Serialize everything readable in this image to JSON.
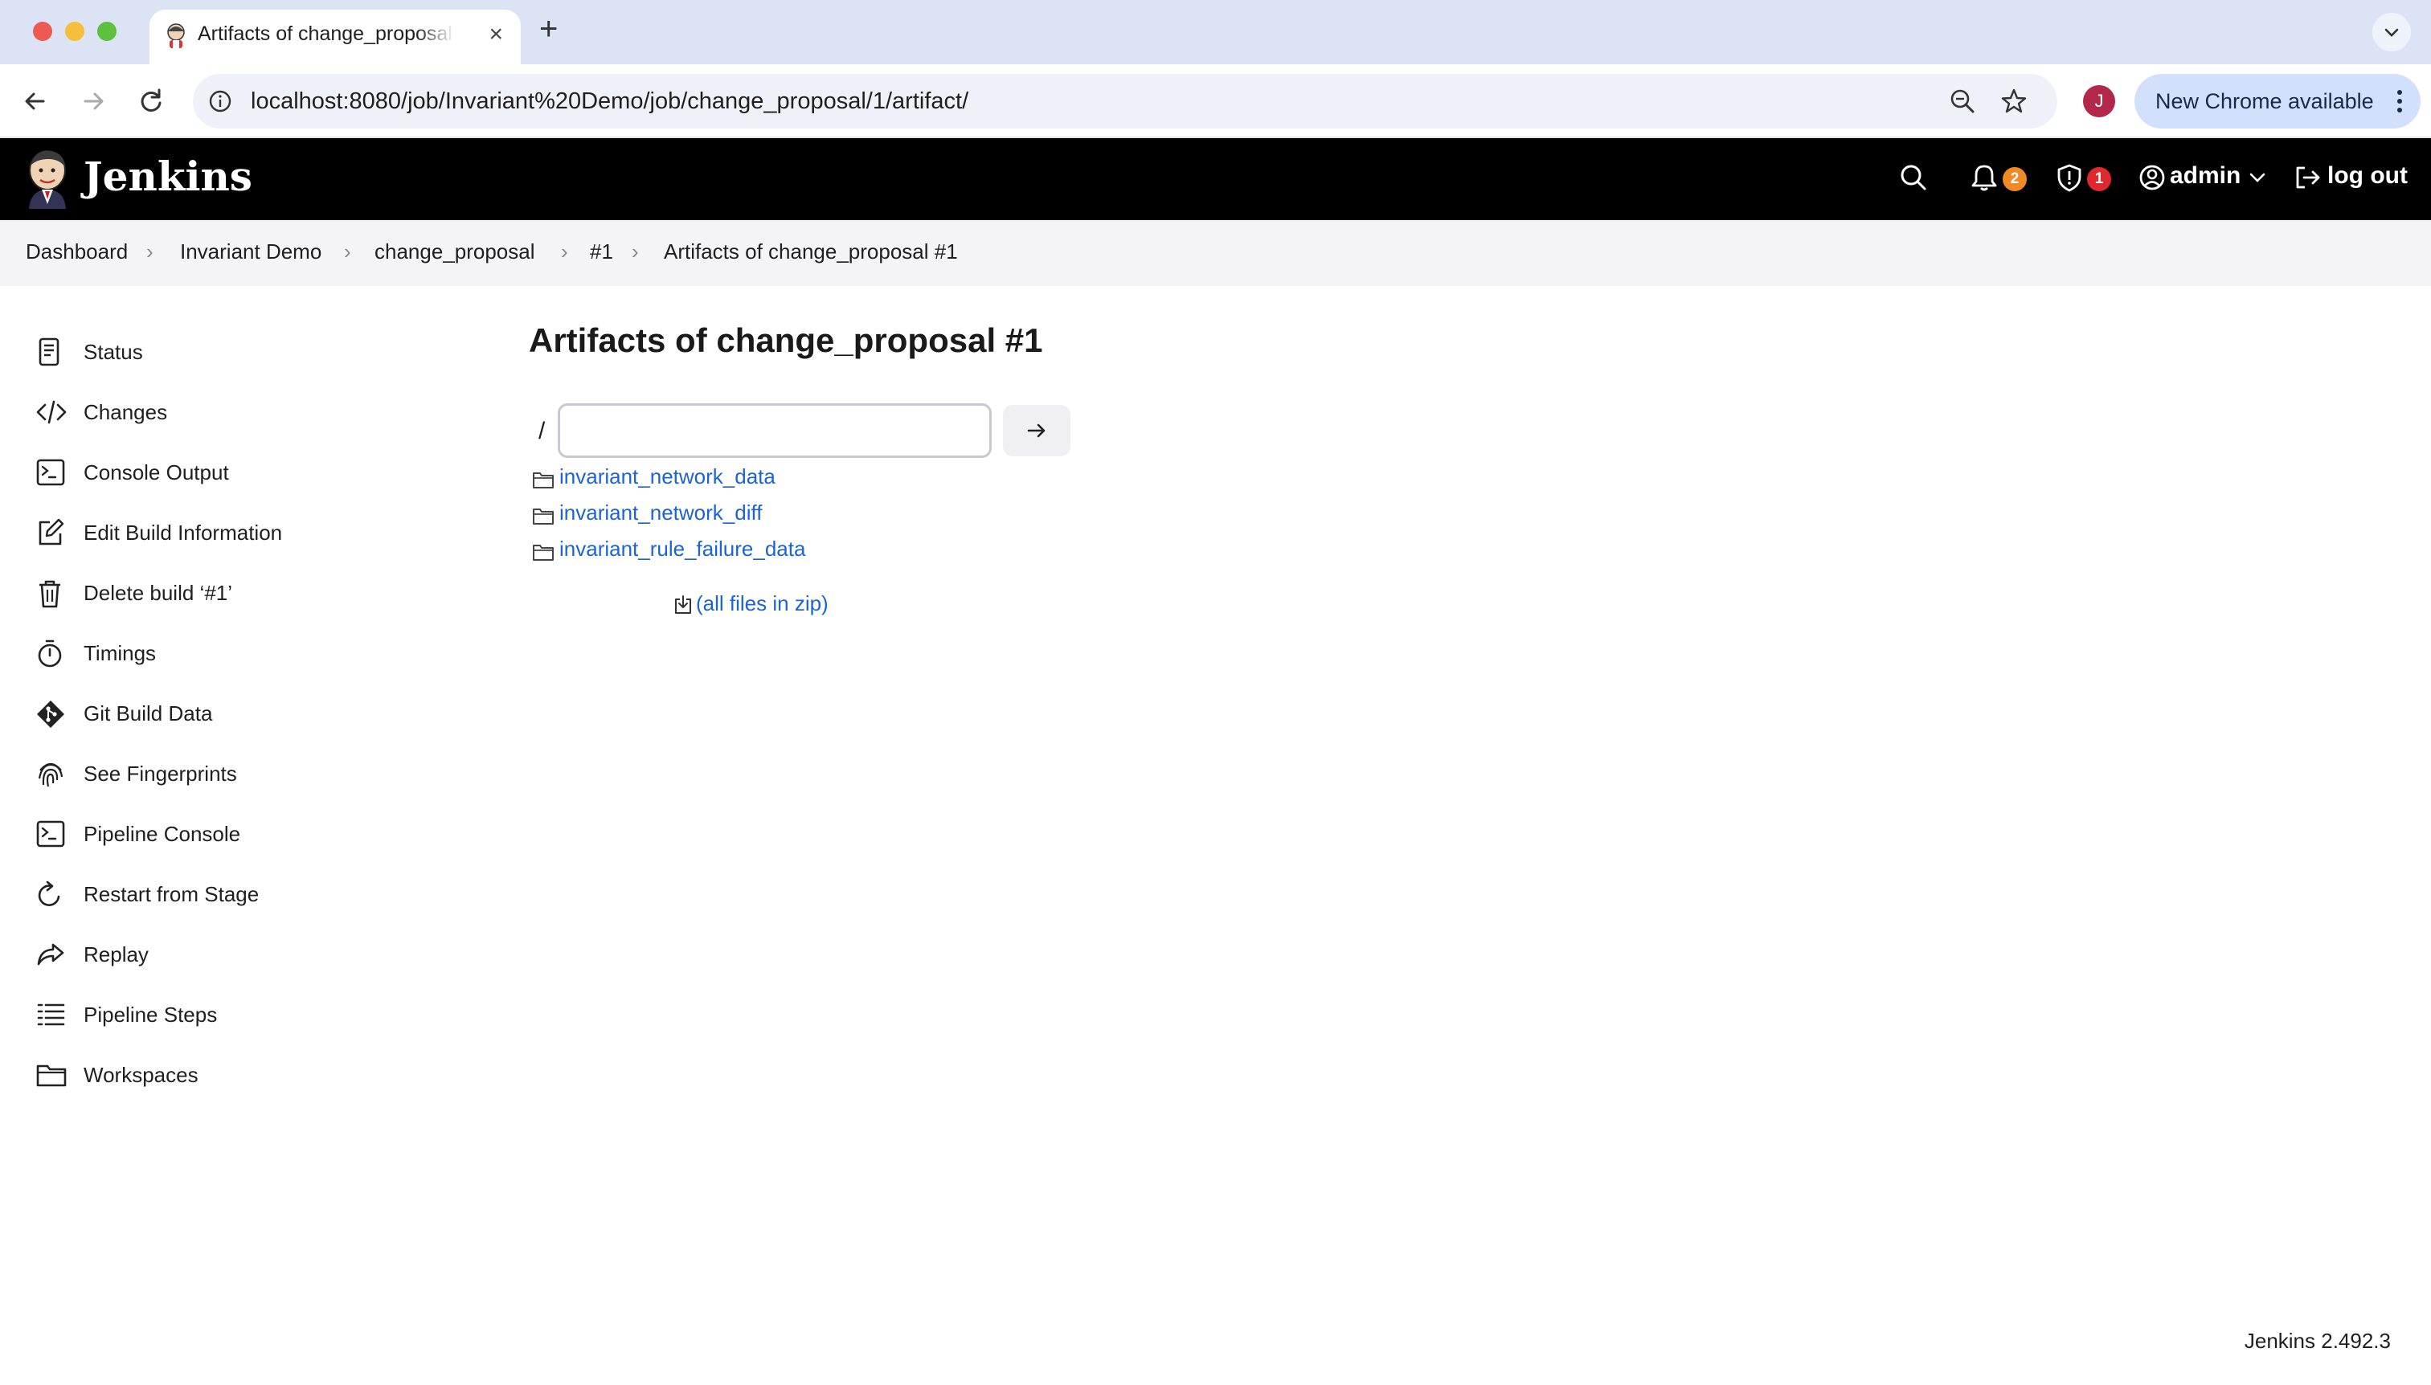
{
  "browser": {
    "tab_title": "Artifacts of change_proposal #1",
    "url": "localhost:8080/job/Invariant%20Demo/job/change_proposal/1/artifact/",
    "profile_initial": "J",
    "update_label": "New Chrome available"
  },
  "header": {
    "app_title": "Jenkins",
    "notifications_count": "2",
    "security_count": "1",
    "user": "admin",
    "logout_label": "log out"
  },
  "breadcrumb": [
    "Dashboard",
    "Invariant Demo",
    "change_proposal",
    "#1",
    "Artifacts of change_proposal #1"
  ],
  "sidebar": {
    "items": [
      {
        "label": "Status",
        "icon": "document-icon"
      },
      {
        "label": "Changes",
        "icon": "code-icon"
      },
      {
        "label": "Console Output",
        "icon": "terminal-icon"
      },
      {
        "label": "Edit Build Information",
        "icon": "edit-icon"
      },
      {
        "label": "Delete build ‘#1’",
        "icon": "trash-icon"
      },
      {
        "label": "Timings",
        "icon": "stopwatch-icon"
      },
      {
        "label": "Git Build Data",
        "icon": "git-icon"
      },
      {
        "label": "See Fingerprints",
        "icon": "fingerprint-icon"
      },
      {
        "label": "Pipeline Console",
        "icon": "terminal-icon"
      },
      {
        "label": "Restart from Stage",
        "icon": "restart-icon"
      },
      {
        "label": "Replay",
        "icon": "replay-icon"
      },
      {
        "label": "Pipeline Steps",
        "icon": "list-icon"
      },
      {
        "label": "Workspaces",
        "icon": "folder-icon"
      }
    ]
  },
  "main": {
    "title": "Artifacts of change_proposal #1",
    "path_prefix": "/",
    "path_value": "",
    "artifacts": [
      "invariant_network_data",
      "invariant_network_diff",
      "invariant_rule_failure_data"
    ],
    "zip_label": "(all files in zip)"
  },
  "footer": {
    "version": "Jenkins 2.492.3"
  },
  "colors": {
    "link": "#1c64d6",
    "header_bg": "#000000",
    "badge_notifications": "#f08a24",
    "badge_security": "#e0292e"
  }
}
